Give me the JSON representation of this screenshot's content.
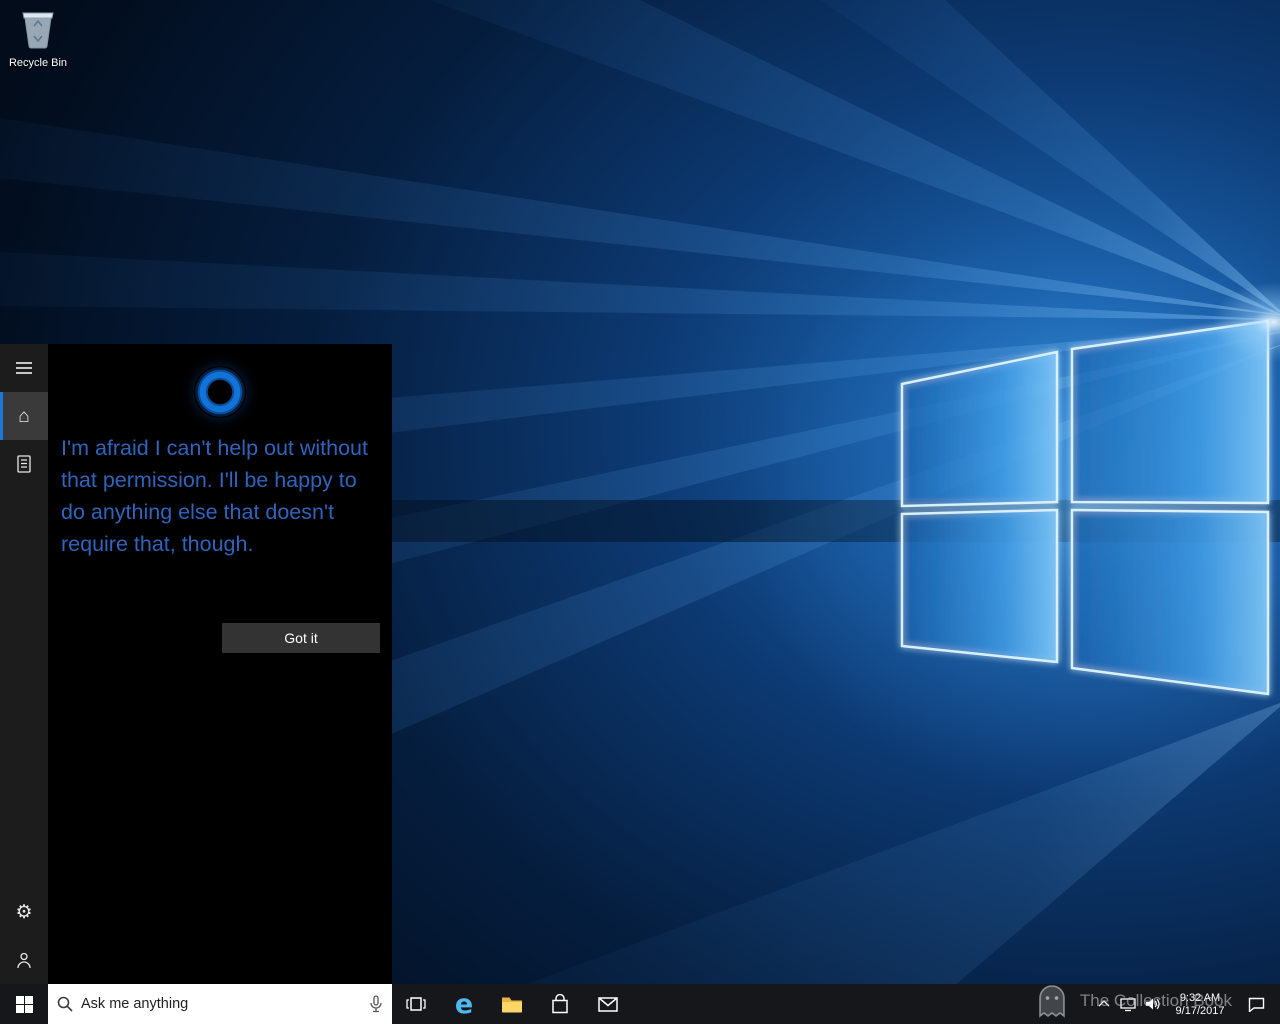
{
  "desktop": {
    "recycle_bin": {
      "label": "Recycle Bin"
    }
  },
  "cortana": {
    "message": "I'm afraid I can't help out without that permission. I'll be happy to do anything else that doesn't require that, though.",
    "got_it_label": "Got it",
    "text_color": "#2f64bd"
  },
  "taskbar": {
    "search": {
      "placeholder": "Ask me anything"
    },
    "clock": {
      "time": "9:32 AM",
      "date": "9/17/2017"
    }
  },
  "watermark": {
    "text": "The Collection Book"
  },
  "icons": {
    "edge_letter": "e",
    "home_glyph": "⌂",
    "gear_glyph": "⚙"
  },
  "colors": {
    "accent_blue": "#1f7ad6",
    "edge_blue": "#52b8f0",
    "folder_yellow": "#ffd567",
    "taskbar_bg": "#16171b"
  }
}
